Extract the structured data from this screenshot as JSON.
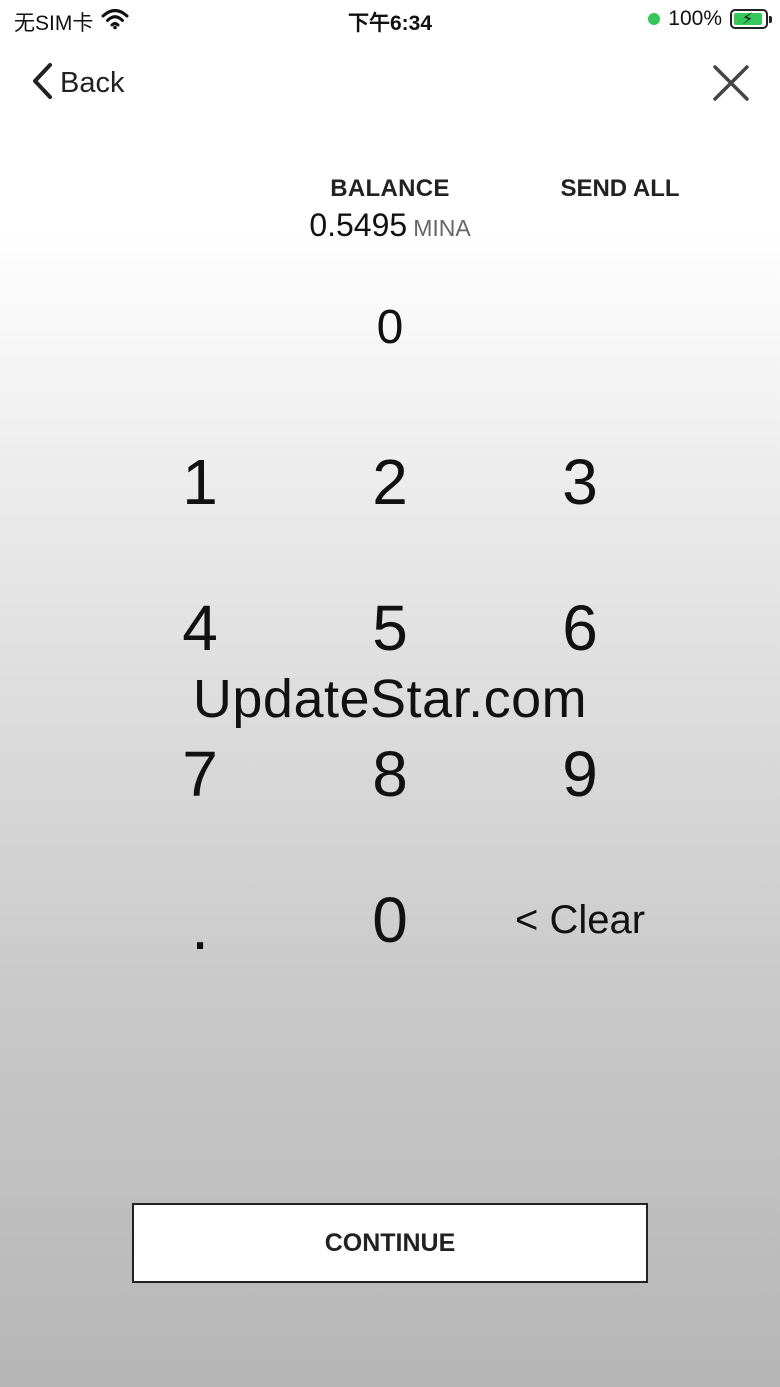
{
  "status_bar": {
    "carrier": "无SIM卡",
    "time": "下午6:34",
    "battery": "100%",
    "battery_level": 1.0,
    "icons": {
      "wifi": "wifi-icon",
      "charging": "charging-bolt-icon",
      "dot": "green-dot-indicator"
    },
    "colors": {
      "battery_fill": "#35c759",
      "dot": "#35c759"
    }
  },
  "nav": {
    "back_label": "Back",
    "back_icon": "chevron-left-icon",
    "close_icon": "close-icon"
  },
  "balance": {
    "label": "BALANCE",
    "value": "0.5495",
    "unit": "MINA"
  },
  "send_all_label": "SEND ALL",
  "amount": "0",
  "keypad": {
    "keys": [
      "1",
      "2",
      "3",
      "4",
      "5",
      "6",
      "7",
      "8",
      "9",
      ".",
      "0",
      "< Clear"
    ]
  },
  "watermark": "UpdateStar.com",
  "continue_label": "CONTINUE"
}
